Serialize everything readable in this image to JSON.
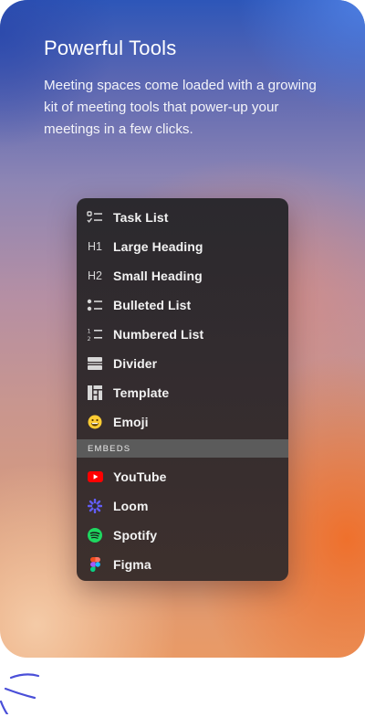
{
  "header": {
    "title": "Powerful Tools",
    "description": "Meeting spaces come loaded with a growing kit of meeting tools that power-up your meetings in a few clicks."
  },
  "menu": {
    "items": [
      {
        "label": "Task List",
        "icon": "task-list-icon"
      },
      {
        "label": "Large Heading",
        "icon": "h1-icon",
        "glyph": "H1"
      },
      {
        "label": "Small Heading",
        "icon": "h2-icon",
        "glyph": "H2"
      },
      {
        "label": "Bulleted List",
        "icon": "bulleted-list-icon"
      },
      {
        "label": "Numbered List",
        "icon": "numbered-list-icon"
      },
      {
        "label": "Divider",
        "icon": "divider-icon"
      },
      {
        "label": "Template",
        "icon": "template-icon"
      },
      {
        "label": "Emoji",
        "icon": "emoji-icon"
      }
    ],
    "section_label": "EMBEDS",
    "embeds": [
      {
        "label": "YouTube",
        "icon": "youtube-icon"
      },
      {
        "label": "Loom",
        "icon": "loom-icon"
      },
      {
        "label": "Spotify",
        "icon": "spotify-icon"
      },
      {
        "label": "Figma",
        "icon": "figma-icon"
      }
    ]
  },
  "colors": {
    "youtube": "#ff0000",
    "loom": "#625df5",
    "spotify": "#1ed760",
    "emoji": "#ffcc33"
  }
}
